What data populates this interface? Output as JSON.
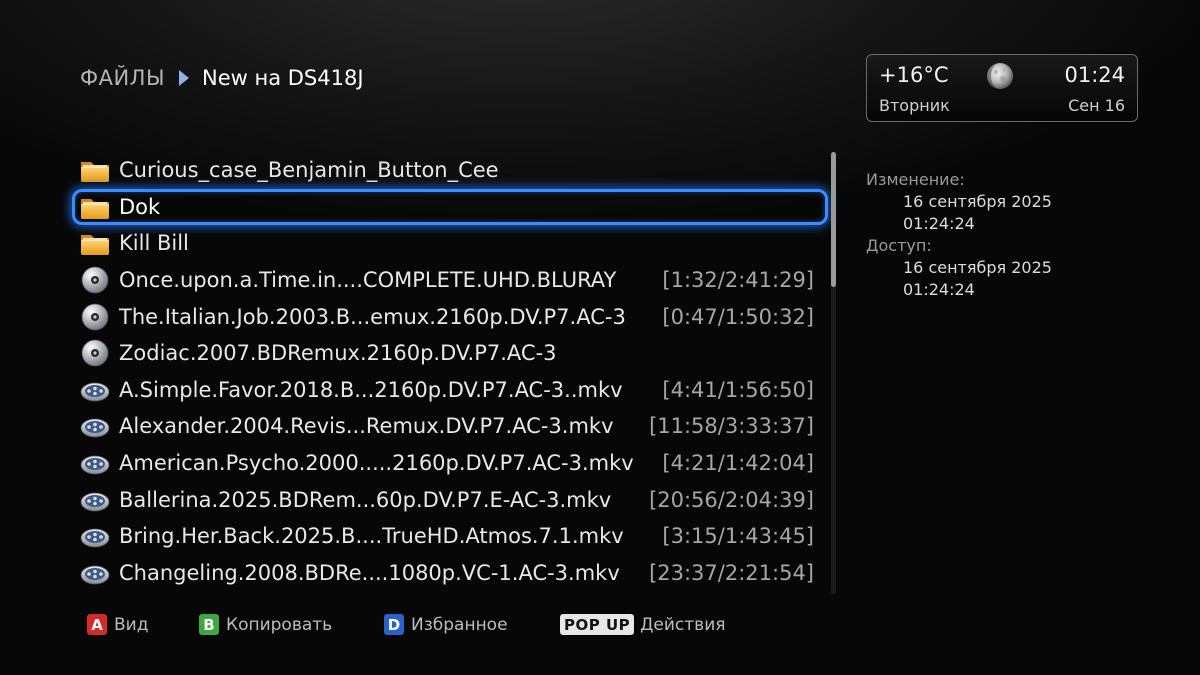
{
  "breadcrumb": {
    "root": "ФАЙЛЫ",
    "current": "New на DS418J"
  },
  "widget": {
    "temperature": "+16°C",
    "time": "01:24",
    "day": "Вторник",
    "date": "Сен 16",
    "weather_icon": "moon-icon"
  },
  "files": [
    {
      "type": "folder",
      "name": "Curious_case_Benjamin_Button_Cee",
      "time": ""
    },
    {
      "type": "folder",
      "name": "Dok",
      "time": "",
      "selected": true
    },
    {
      "type": "folder",
      "name": "Kill Bill",
      "time": ""
    },
    {
      "type": "disc",
      "name": "Once.upon.a.Time.in....COMPLETE.UHD.BLURAY",
      "time": "[1:32/2:41:29]"
    },
    {
      "type": "disc",
      "name": "The.Italian.Job.2003.B...emux.2160p.DV.P7.AC-3",
      "time": "[0:47/1:50:32]"
    },
    {
      "type": "disc",
      "name": "Zodiac.2007.BDRemux.2160p.DV.P7.AC-3",
      "time": ""
    },
    {
      "type": "video",
      "name": "A.Simple.Favor.2018.B...2160p.DV.P7.AC-3..mkv",
      "time": "[4:41/1:56:50]"
    },
    {
      "type": "video",
      "name": "Alexander.2004.Revis...Remux.DV.P7.AC-3.mkv",
      "time": "[11:58/3:33:37]"
    },
    {
      "type": "video",
      "name": "American.Psycho.2000.....2160p.DV.P7.AC-3.mkv",
      "time": "[4:21/1:42:04]"
    },
    {
      "type": "video",
      "name": "Ballerina.2025.BDRem...60p.DV.P7.E-AC-3.mkv",
      "time": "[20:56/2:04:39]"
    },
    {
      "type": "video",
      "name": "Bring.Her.Back.2025.B....TrueHD.Atmos.7.1.mkv",
      "time": "[3:15/1:43:45]"
    },
    {
      "type": "video",
      "name": "Changeling.2008.BDRe....1080p.VC-1.AC-3.mkv",
      "time": "[23:37/2:21:54]"
    }
  ],
  "info": {
    "modified_label": "Изменение:",
    "modified_date": "16 сентября 2025",
    "modified_time": "01:24:24",
    "access_label": "Доступ:",
    "access_date": "16 сентября 2025",
    "access_time": "01:24:24"
  },
  "hints": {
    "a_key": "A",
    "a_label": "Вид",
    "a_color": "#d42a2a",
    "b_key": "B",
    "b_label": "Копировать",
    "b_color": "#3ea83e",
    "d_key": "D",
    "d_label": "Избранное",
    "d_color": "#2a63c8",
    "popup_key": "POP UP",
    "popup_label": "Действия"
  },
  "colors": {
    "selection": "#3b8cff",
    "folder": "#f2b53a"
  }
}
